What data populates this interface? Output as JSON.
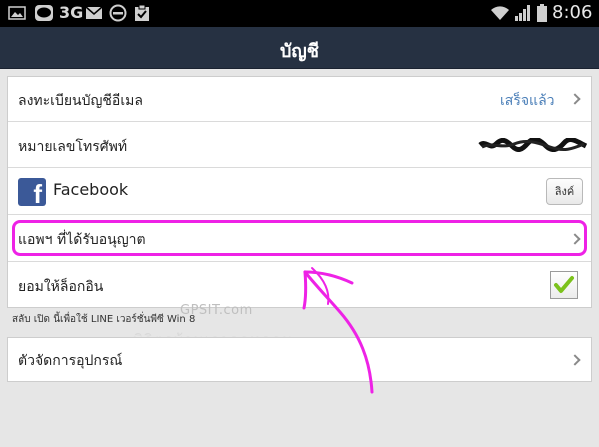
{
  "status_bar": {
    "network": "3G",
    "time": "8:06",
    "icons": [
      "image-icon",
      "line-app-icon",
      "mail-icon",
      "do-not-disturb-icon",
      "clipboard-check-icon",
      "wifi-icon",
      "signal-icon",
      "battery-icon"
    ]
  },
  "header": {
    "title": "บัญชี"
  },
  "account": {
    "email_label": "ลงทะเบียนบัญชีอีเมล",
    "email_status": "เสร็จแล้ว",
    "phone_label": "หมายเลขโทรศัพท์",
    "facebook_label": "Facebook",
    "facebook_button": "ลิงค์",
    "authorized_apps_label": "แอพฯ ที่ได้รับอนุญาต",
    "allow_login_label": "ยอมให้ล็อกอิน",
    "allow_login_checked": true
  },
  "hint": "สลับ เปิด นี้เพื่อใช้ LINE เวอร์ชั่นพีซี Win 8",
  "device": {
    "label": "ตัวจัดการอุปกรณ์"
  },
  "watermark": {
    "site": "GPSIT.com",
    "thai": "พิจิตรบ้านเราดอทคอม"
  },
  "colors": {
    "title_bar": "#263142",
    "highlight": "#ee22e6",
    "link": "#4b7fb8",
    "check": "#7cc21c"
  }
}
